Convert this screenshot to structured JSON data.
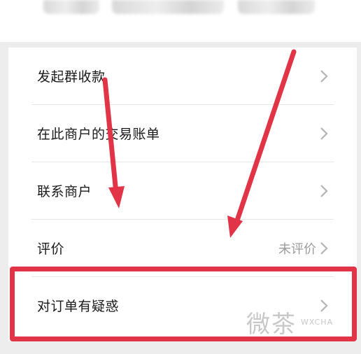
{
  "menu": {
    "items": [
      {
        "label": "发起群收款",
        "value": ""
      },
      {
        "label": "在此商户的交易账单",
        "value": ""
      },
      {
        "label": "联系商户",
        "value": ""
      },
      {
        "label": "评价",
        "value": "未评价"
      },
      {
        "label": "对订单有疑惑",
        "value": ""
      }
    ]
  },
  "annotations": {
    "arrow_color": "#e23447",
    "highlight_color": "#e23447"
  },
  "watermark": {
    "text_cn": "微茶",
    "text_en": "WXCHA"
  }
}
